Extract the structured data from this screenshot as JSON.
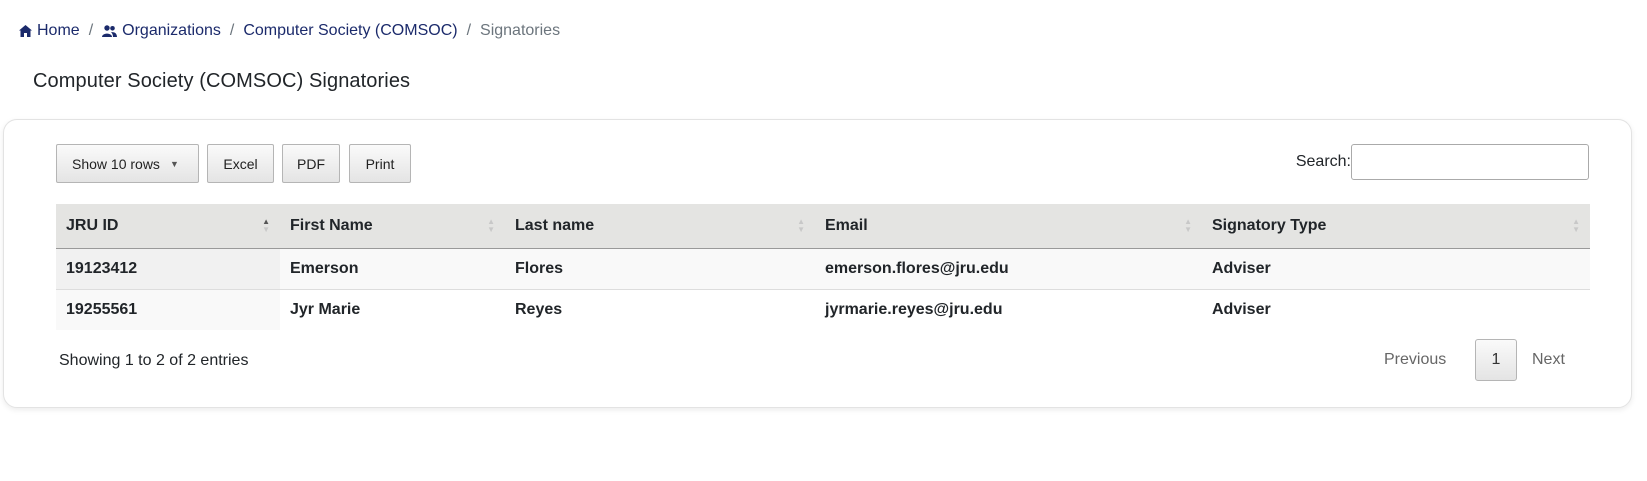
{
  "breadcrumb": {
    "home": "Home",
    "organizations": "Organizations",
    "organization": "Computer Society (COMSOC)",
    "current": "Signatories",
    "separator": "/"
  },
  "page_title": "Computer Society (COMSOC) Signatories",
  "toolbar": {
    "rows_label": "Show 10 rows",
    "excel_label": "Excel",
    "pdf_label": "PDF",
    "print_label": "Print",
    "search_label": "Search:",
    "search_value": ""
  },
  "table": {
    "columns": [
      "JRU ID",
      "First Name",
      "Last name",
      "Email",
      "Signatory Type"
    ],
    "rows": [
      [
        "19123412",
        "Emerson",
        "Flores",
        "emerson.flores@jru.edu",
        "Adviser"
      ],
      [
        "19255561",
        "Jyr Marie",
        "Reyes",
        "jyrmarie.reyes@jru.edu",
        "Adviser"
      ]
    ]
  },
  "footer": {
    "info": "Showing 1 to 2 of 2 entries",
    "previous": "Previous",
    "page": "1",
    "next": "Next"
  },
  "colors": {
    "link": "#1b2a6b",
    "header_bg": "#e4e4e2"
  }
}
